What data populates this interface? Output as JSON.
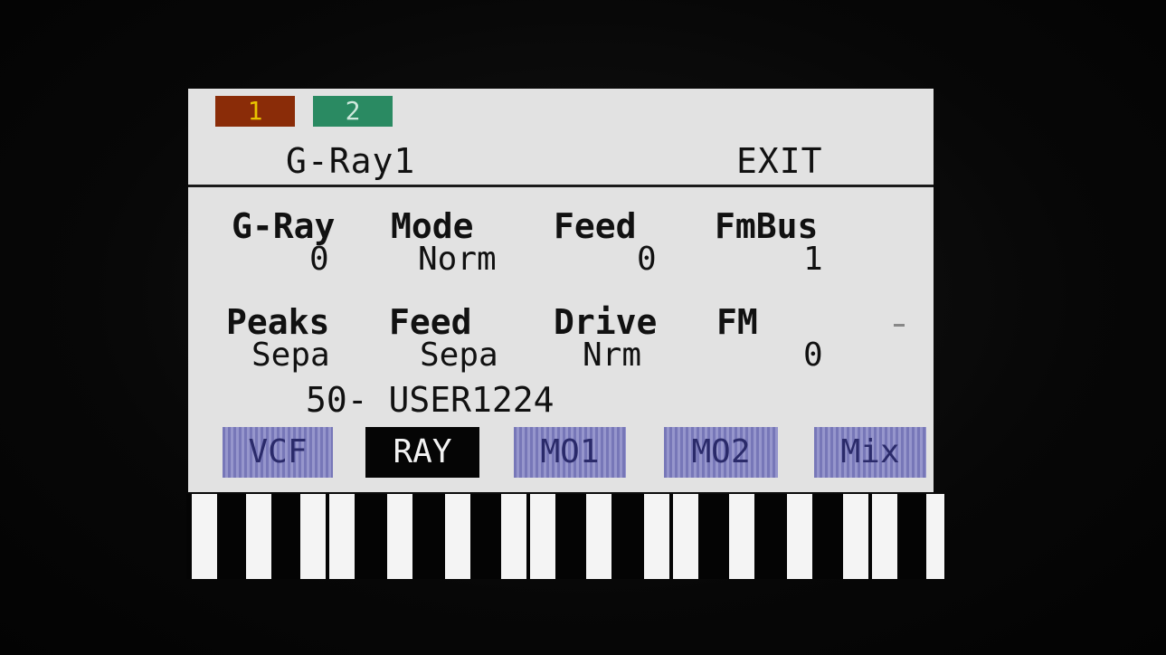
{
  "tracks": [
    "1",
    "2"
  ],
  "header": {
    "title": "G-Ray1",
    "exit_label": "EXIT"
  },
  "row1": {
    "labels": [
      "G-Ray",
      "Mode",
      "Feed",
      "FmBus"
    ],
    "values": [
      "0",
      "Norm",
      "0",
      "1"
    ]
  },
  "row2": {
    "labels": [
      "Peaks",
      "Feed",
      "Drive",
      "FM"
    ],
    "values": [
      "Sepa",
      "Sepa",
      "Nrm",
      "0"
    ],
    "trailing": "-"
  },
  "preset": "50- USER1224",
  "tabs": [
    {
      "label": "VCF",
      "active": false
    },
    {
      "label": "RAY",
      "active": true
    },
    {
      "label": "MO1",
      "active": false
    },
    {
      "label": "MO2",
      "active": false
    },
    {
      "label": "Mix",
      "active": false
    }
  ],
  "colors": {
    "screen_bg": "#e2e2e2",
    "track1": "#8a2c08",
    "track2": "#2a8a62",
    "tab_inactive": "#8585c0",
    "tab_active": "#050505"
  }
}
